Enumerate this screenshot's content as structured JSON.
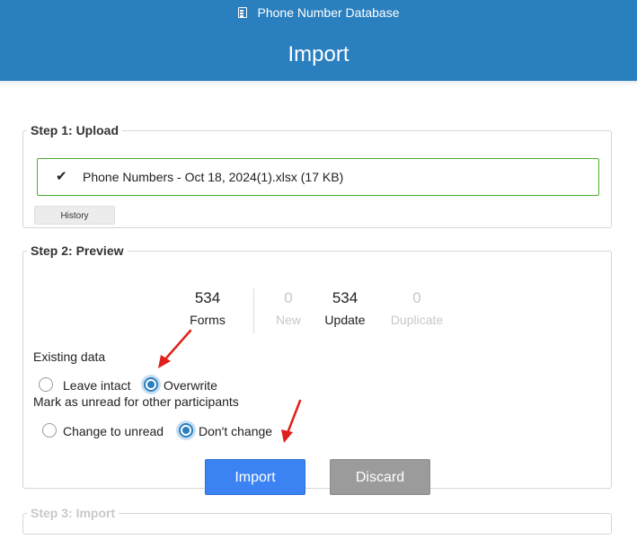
{
  "header": {
    "app_icon": "document-icon",
    "app_title": "Phone Number Database",
    "page_title": "Import"
  },
  "step1": {
    "legend": "Step 1: Upload",
    "status_icon": "checkmark-icon",
    "file_label": "Phone Numbers - Oct 18, 2024(1).xlsx (17 KB)",
    "history_label": "History",
    "accent_color": "#4cae34"
  },
  "step2": {
    "legend": "Step 2: Preview",
    "stats": [
      {
        "value": "534",
        "label": "Forms"
      },
      {
        "value": "0",
        "label": "New"
      },
      {
        "value": "534",
        "label": "Update"
      },
      {
        "value": "0",
        "label": "Duplicate"
      }
    ],
    "existing_data": {
      "label": "Existing data",
      "options": [
        {
          "label": "Leave intact",
          "selected": false
        },
        {
          "label": "Overwrite",
          "selected": true
        }
      ]
    },
    "mark_unread": {
      "label": "Mark as unread for other participants",
      "options": [
        {
          "label": "Change to unread",
          "selected": false
        },
        {
          "label": "Don't change",
          "selected": true
        }
      ]
    },
    "import_label": "Import",
    "discard_label": "Discard"
  },
  "step3": {
    "legend": "Step 3: Import"
  },
  "colors": {
    "header_bg": "#2a7fbf",
    "primary_button": "#3b83f2",
    "secondary_button": "#9b9b9b",
    "radio_selected": "#2a7fbf",
    "annotation_arrow": "#e0201a"
  }
}
